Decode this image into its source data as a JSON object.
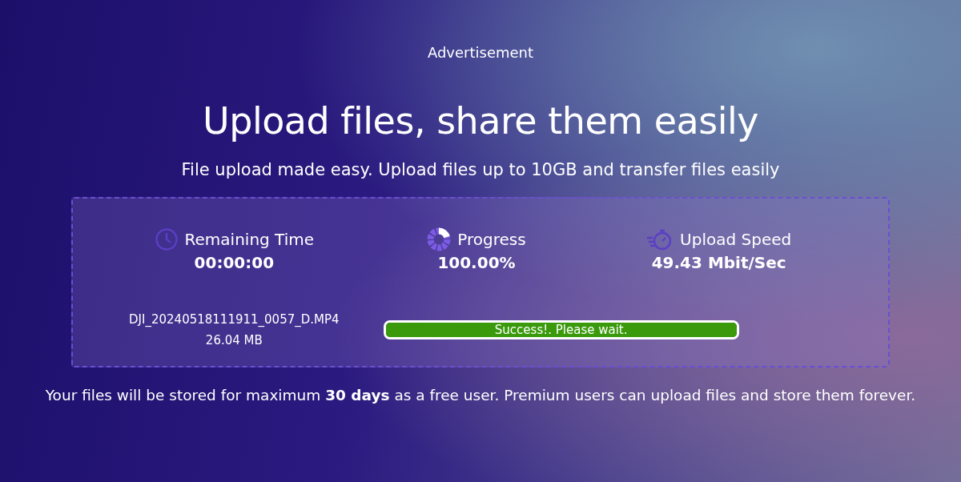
{
  "advertisement": "Advertisement",
  "title": "Upload files, share them easily",
  "subtitle": "File upload made easy. Upload files up to 10GB and transfer files easily",
  "stats": [
    {
      "kind": "clock",
      "label": "Remaining Time",
      "value": "00:00:00"
    },
    {
      "kind": "progress",
      "label": "Progress",
      "value": "100.00%"
    },
    {
      "kind": "speed",
      "label": "Upload Speed",
      "value": "49.43 Mbit/Sec"
    }
  ],
  "file": {
    "name": "DJI_20240518111911_0057_D.MP4",
    "size": "26.04 MB"
  },
  "progress_bar": {
    "level": 1.0,
    "label": "Success!. Please wait."
  },
  "footer_note": "Your files will be stored for maximum **30 days** as a free user. Premium users can upload files and store them forever."
}
